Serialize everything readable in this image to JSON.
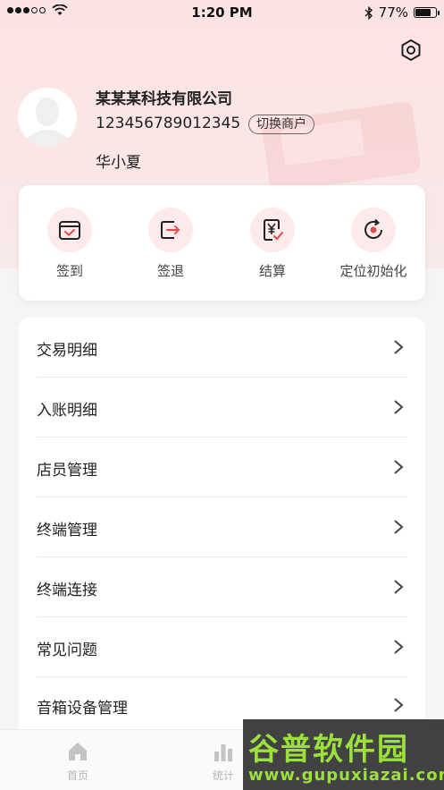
{
  "status_bar": {
    "time": "1:20 PM",
    "battery": "77%",
    "battery_level": 0.77
  },
  "profile": {
    "company": "某某某科技有限公司",
    "merchant_id": "123456789012345",
    "switch_label": "切换商户",
    "user_name": "华小夏"
  },
  "actions": [
    {
      "label": "签到",
      "icon": "calendar-check-icon"
    },
    {
      "label": "签退",
      "icon": "exit-icon"
    },
    {
      "label": "结算",
      "icon": "yuan-receipt-icon"
    },
    {
      "label": "定位初始化",
      "icon": "refresh-location-icon"
    }
  ],
  "menu": [
    {
      "label": "交易明细"
    },
    {
      "label": "入账明细"
    },
    {
      "label": "店员管理"
    },
    {
      "label": "终端管理"
    },
    {
      "label": "终端连接"
    },
    {
      "label": "常见问题"
    },
    {
      "label": "音箱设备管理"
    }
  ],
  "tabs": [
    {
      "label": "首页",
      "icon": "home-icon"
    },
    {
      "label": "统计",
      "icon": "bar-chart-icon"
    }
  ],
  "watermark": {
    "main": "谷普软件园",
    "url": "www.gupuxiazai.com"
  },
  "colors": {
    "accent": "#e84a4a",
    "hero_bg": "#fce3e3",
    "icon_bg": "#fdebeb"
  }
}
